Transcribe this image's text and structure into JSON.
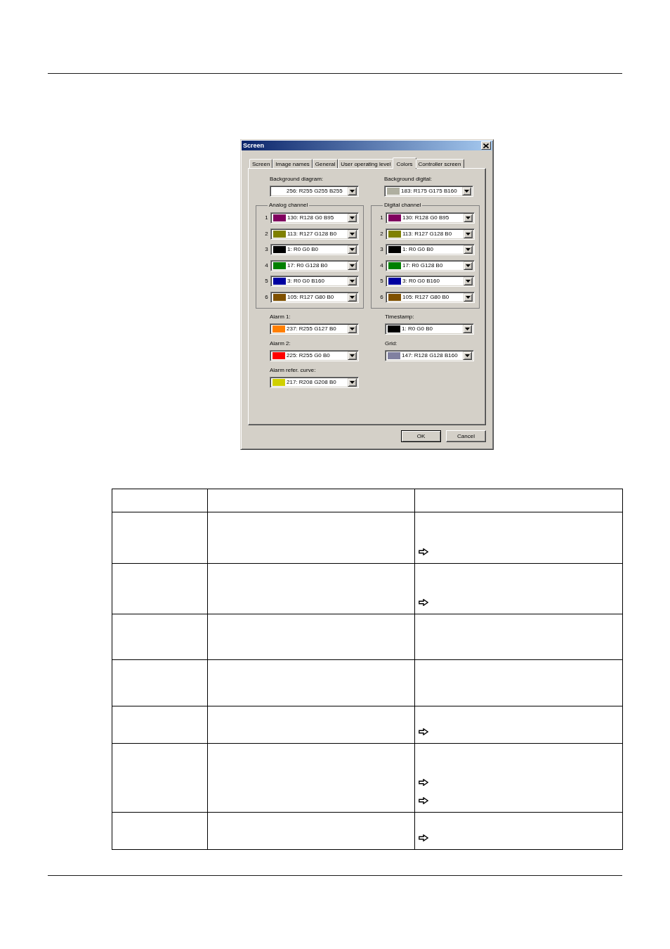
{
  "window": {
    "title": "Screen"
  },
  "tabs": [
    {
      "label": "Screen",
      "selected": false
    },
    {
      "label": "Image names",
      "selected": false
    },
    {
      "label": "General",
      "selected": false
    },
    {
      "label": "User operating level",
      "selected": false
    },
    {
      "label": "Colors",
      "selected": true
    },
    {
      "label": "Controller screen",
      "selected": false
    }
  ],
  "background": [
    {
      "label": "Background diagram:",
      "value": "256: R255 G255 B255",
      "color": "#ffffff"
    },
    {
      "label": "Background digital:",
      "value": "183: R175 G175 B160",
      "color": "#afafa0"
    }
  ],
  "analog_channel": {
    "title": "Analog channel",
    "channels": [
      {
        "number": "1",
        "value": "130: R128 G0 B95",
        "color": "#80005f"
      },
      {
        "number": "2",
        "value": "113: R127 G128 B0",
        "color": "#7f8000"
      },
      {
        "number": "3",
        "value": "1: R0 G0 B0",
        "color": "#000000"
      },
      {
        "number": "4",
        "value": "17: R0 G128 B0",
        "color": "#008000"
      },
      {
        "number": "5",
        "value": "3: R0 G0 B160",
        "color": "#0000a0"
      },
      {
        "number": "6",
        "value": "105: R127 G80 B0",
        "color": "#7f5000"
      }
    ]
  },
  "digital_channel": {
    "title": "Digital channel",
    "channels": [
      {
        "number": "1",
        "value": "130: R128 G0 B95",
        "color": "#80005f"
      },
      {
        "number": "2",
        "value": "113: R127 G128 B0",
        "color": "#7f8000"
      },
      {
        "number": "3",
        "value": "1: R0 G0 B0",
        "color": "#000000"
      },
      {
        "number": "4",
        "value": "17: R0 G128 B0",
        "color": "#008000"
      },
      {
        "number": "5",
        "value": "3: R0 G0 B160",
        "color": "#0000a0"
      },
      {
        "number": "6",
        "value": "105: R127 G80 B0",
        "color": "#7f5000"
      }
    ]
  },
  "alarms": [
    {
      "label": "Alarm 1:",
      "value": "237: R255 G127 B0",
      "color": "#ff7f00"
    },
    {
      "label": "Alarm 2:",
      "value": "225: R255 G0 B0",
      "color": "#ff0000"
    },
    {
      "label": "Alarm refer. curve:",
      "value": "217: R208 G208 B0",
      "color": "#d0d000"
    }
  ],
  "other_colors": [
    {
      "label": "Timestamp:",
      "value": "1: R0 G0 B0",
      "color": "#000000"
    },
    {
      "label": "Grid:",
      "value": "147: R128 G128 B160",
      "color": "#8080a0"
    }
  ],
  "buttons": [
    {
      "label": "OK",
      "kind": "default"
    },
    {
      "label": "Cancel",
      "kind": "normal"
    }
  ],
  "table": {
    "rows": [
      {
        "kind": "header"
      },
      {
        "kind": "body",
        "notes": [
          {
            "kind": "arrow"
          }
        ]
      },
      {
        "kind": "body",
        "notes": [
          {
            "kind": "arrow"
          }
        ]
      },
      {
        "kind": "body"
      },
      {
        "kind": "body"
      },
      {
        "kind": "body",
        "notes": [
          {
            "kind": "arrow"
          }
        ]
      },
      {
        "kind": "body",
        "notes": [
          {
            "kind": "arrow"
          },
          {
            "kind": "arrow"
          }
        ]
      },
      {
        "kind": "body",
        "notes": [
          {
            "kind": "arrow"
          }
        ]
      }
    ]
  }
}
